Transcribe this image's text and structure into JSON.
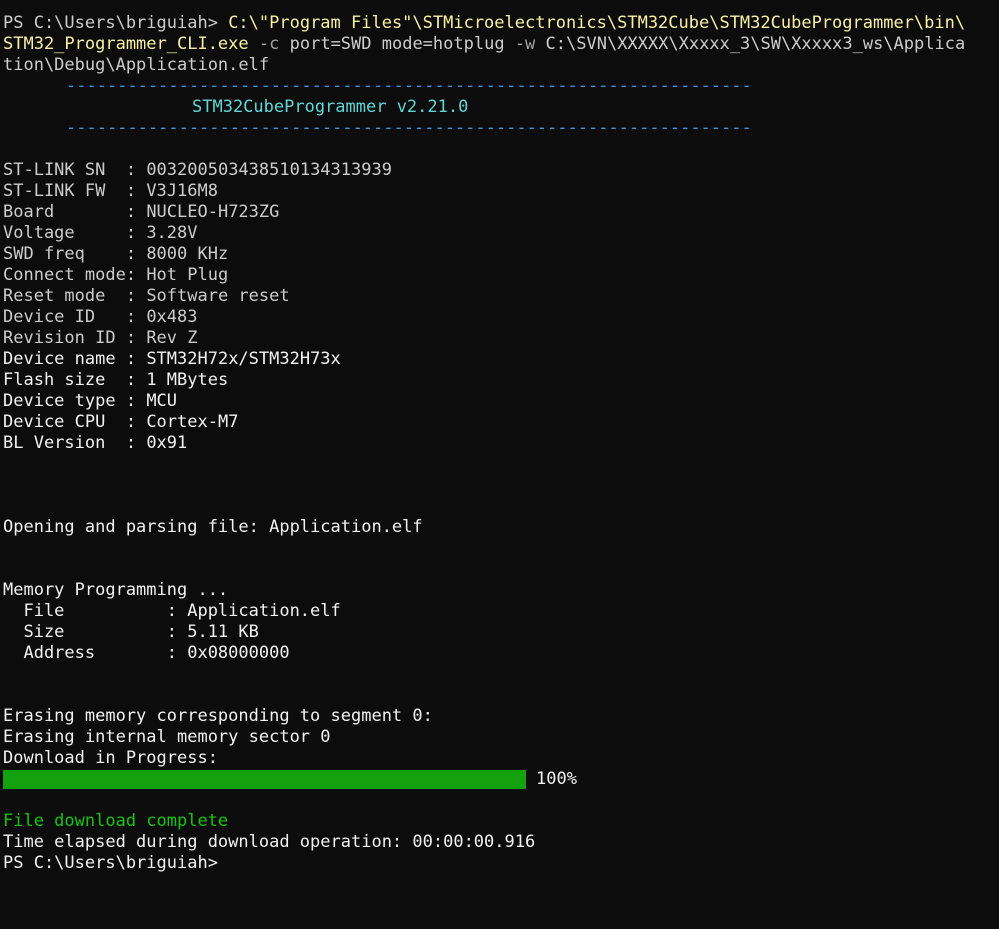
{
  "prompt_1": "PS C:\\Users\\briguiah>",
  "command": {
    "exe_line1": "C:\\\"Program Files\"\\STMicroelectronics\\STM32Cube\\STM32CubeProgrammer\\bin\\",
    "exe_line2": "STM32_Programmer_CLI.exe",
    "flag_c": "-c",
    "arg_c": "port=SWD mode=hotplug",
    "flag_w": "-w",
    "arg_w_1": "C:\\SVN\\XXXXX\\Xxxxx_3\\SW\\Xxxxx3_ws\\Applica",
    "arg_w_2": "tion\\Debug\\Application.elf"
  },
  "banner": {
    "rule": "-------------------------------------------------------------------",
    "title": "STM32CubeProgrammer v2.21.0"
  },
  "device_info": [
    {
      "key": "ST-LINK SN  ",
      "value": "003200503438510134313939"
    },
    {
      "key": "ST-LINK FW  ",
      "value": "V3J16M8"
    },
    {
      "key": "Board       ",
      "value": "NUCLEO-H723ZG"
    },
    {
      "key": "Voltage     ",
      "value": "3.28V"
    },
    {
      "key": "SWD freq    ",
      "value": "8000 KHz"
    },
    {
      "key": "Connect mode",
      "value": "Hot Plug"
    },
    {
      "key": "Reset mode  ",
      "value": "Software reset"
    },
    {
      "key": "Device ID   ",
      "value": "0x483"
    },
    {
      "key": "Revision ID ",
      "value": "Rev Z"
    },
    {
      "key": "Device name ",
      "value": "STM32H72x/STM32H73x"
    },
    {
      "key": "Flash size  ",
      "value": "1 MBytes"
    },
    {
      "key": "Device type ",
      "value": "MCU"
    },
    {
      "key": "Device CPU  ",
      "value": "Cortex-M7"
    },
    {
      "key": "BL Version  ",
      "value": "0x91"
    }
  ],
  "opening": "Opening and parsing file: Application.elf",
  "memory_programming": {
    "header": "Memory Programming ...",
    "file": "  File          : Application.elf",
    "size": "  Size          : 5.11 KB",
    "address": "  Address       : 0x08000000"
  },
  "erasing_1": "Erasing memory corresponding to segment 0:",
  "erasing_2": "Erasing internal memory sector 0",
  "download_in_progress": "Download in Progress:",
  "progress": {
    "percent_label": "100%",
    "value": 1.0
  },
  "download_complete": "File download complete",
  "time_elapsed": "Time elapsed during download operation: 00:00:00.916",
  "prompt_2": "PS C:\\Users\\briguiah>",
  "colors": {
    "background": "#0c0c0c",
    "default_text": "#cccccc",
    "path_yellow": "#f9f1a5",
    "banner_rule": "#3a96dd",
    "banner_title": "#61d6d6",
    "progress_green": "#13a10e",
    "success_green": "#16c60c"
  }
}
